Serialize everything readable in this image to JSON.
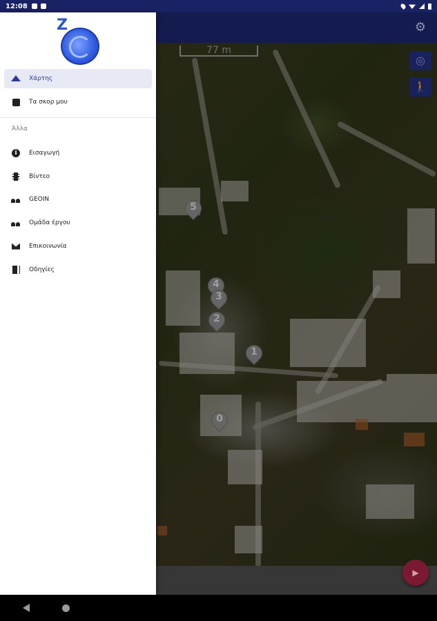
{
  "status_bar": {
    "time": "12:08"
  },
  "map": {
    "scale_label": "77 m",
    "markers": [
      "5",
      "4",
      "3",
      "2",
      "1",
      "0"
    ]
  },
  "drawer": {
    "primary_items": [
      {
        "label": "Χάρτης",
        "icon": "mountain-icon",
        "active": true
      },
      {
        "label": "Τα σκορ μου",
        "icon": "scoreboard-icon",
        "active": false
      }
    ],
    "section_label": "Άλλα",
    "secondary_items": [
      {
        "label": "Εισαγωγή",
        "icon": "info-icon"
      },
      {
        "label": "Βίντεο",
        "icon": "film-icon"
      },
      {
        "label": "GEOIN",
        "icon": "people-icon"
      },
      {
        "label": "Ομάδα έργου",
        "icon": "people-icon"
      },
      {
        "label": "Επικοινωνία",
        "icon": "mail-icon"
      },
      {
        "label": "Οδηγίες",
        "icon": "book-icon"
      }
    ]
  },
  "colors": {
    "app_bar": "#141c4f",
    "accent": "#2b3a9b",
    "fab": "#7b1832"
  }
}
